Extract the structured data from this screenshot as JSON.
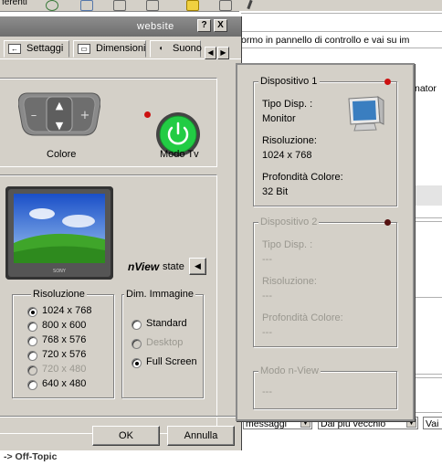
{
  "background": {
    "top_label": "ferenti",
    "page_text": "ormo in pannello di controllo e vai su im",
    "side_text": "nator",
    "filters": [
      "messaggi",
      "Dal più vecchio",
      "Vai"
    ],
    "bottom_link": "-> Off-Topic"
  },
  "dialog": {
    "title": "website",
    "title_buttons": [
      "?",
      "X"
    ],
    "tabs": [
      "Settaggi",
      "Dimensioni",
      "Suono"
    ],
    "colore_label": "Colore",
    "modo_tv_label": "Modo Tv",
    "nview_brand": "nView",
    "nview_state": "state",
    "risoluzione": {
      "title": "Risoluzione",
      "options": [
        "1024 x 768",
        "800 x 600",
        "768 x 576",
        "720 x 576",
        "720 x 480",
        "640 x 480"
      ],
      "selected": "1024 x 768",
      "disabled": [
        "720 x 480"
      ]
    },
    "dim_immagine": {
      "title": "Dim. Immagine",
      "options": [
        "Standard",
        "Desktop",
        "Full Screen"
      ],
      "selected": "Full Screen",
      "disabled": [
        "Desktop"
      ]
    },
    "ok_label": "OK",
    "cancel_label": "Annulla"
  },
  "popup": {
    "device1": {
      "title": "Dispositivo 1",
      "tipo_label": "Tipo Disp. :",
      "tipo_value": "Monitor",
      "res_label": "Risoluzione:",
      "res_value": "1024 x 768",
      "color_label": "Profondità Colore:",
      "color_value": "32 Bit",
      "led_color": "#cc1111"
    },
    "device2": {
      "title": "Dispositivo 2",
      "tipo_label": "Tipo Disp. :",
      "tipo_value": "---",
      "res_label": "Risoluzione:",
      "res_value": "---",
      "color_label": "Profondità Colore:",
      "color_value": "---",
      "led_color": "#551111"
    },
    "modo": {
      "title": "Modo n-View",
      "value": "---"
    }
  },
  "colors": {
    "dialog_bg": "#d4d0c8",
    "titlebar": "#7a7a7a",
    "power_green": "#22cc44",
    "led_red": "#cc1111"
  }
}
